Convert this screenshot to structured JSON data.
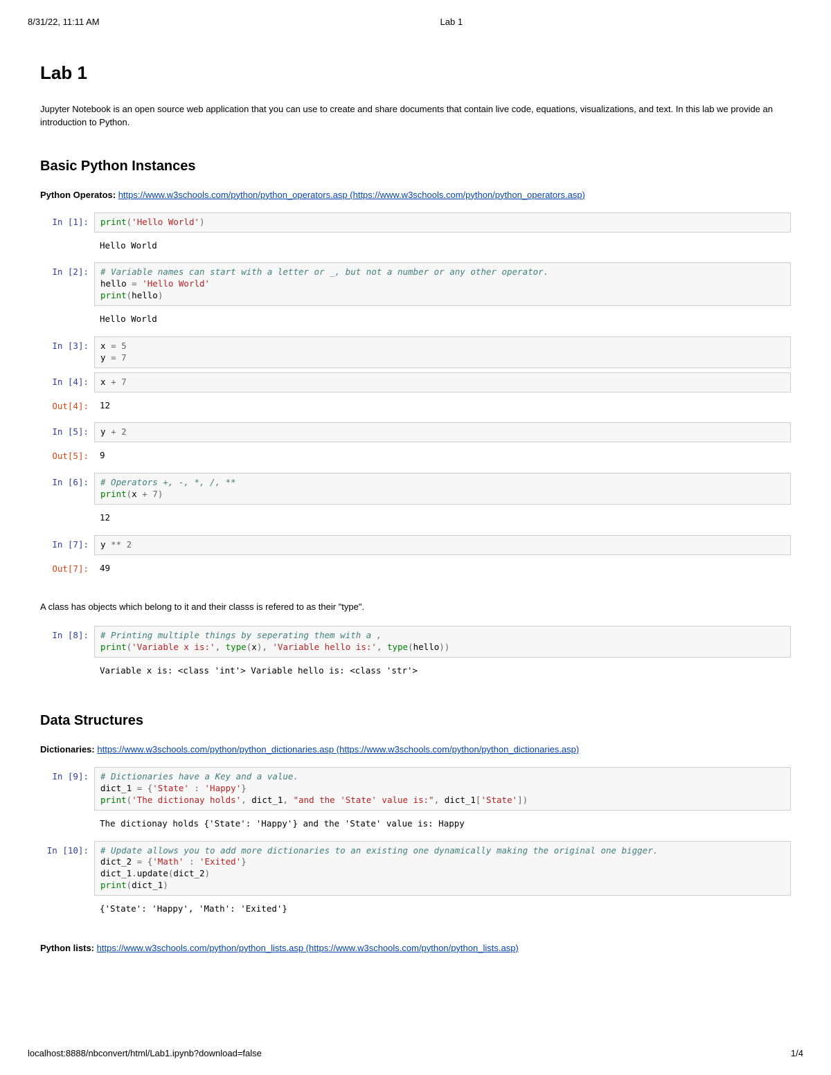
{
  "print": {
    "datetime": "8/31/22, 11:11 AM",
    "title": "Lab 1",
    "url": "localhost:8888/nbconvert/html/Lab1.ipynb?download=false",
    "page": "1/4"
  },
  "doc": {
    "h1": "Lab 1",
    "intro": "Jupyter Notebook is an open source web application that you can use to create and share documents that contain live code, equations, visualizations, and text. In this lab we provide an introduction to Python.",
    "h2a": "Basic Python Instances",
    "ref1_label": "Python Operatos:",
    "ref1_text": "https://www.w3schools.com/python/python_operators.asp (https://www.w3schools.com/python/python_operators.asp)",
    "class_note": "A class has objects which belong to it and their classs is refered to as their \"type\".",
    "h2b": "Data Structures",
    "ref2_label": "Dictionaries:",
    "ref2_text": "https://www.w3schools.com/python/python_dictionaries.asp (https://www.w3schools.com/python/python_dictionaries.asp)",
    "ref3_label": "Python lists:",
    "ref3_text": "https://www.w3schools.com/python/python_lists.asp (https://www.w3schools.com/python/python_lists.asp)"
  },
  "cells": {
    "c1": {
      "in": "In [1]:",
      "out_label": "",
      "stdout": "Hello World",
      "code": [
        [
          [
            "builtin",
            "print"
          ],
          [
            "op",
            "("
          ],
          [
            "str",
            "'Hello World'"
          ],
          [
            "op",
            ")"
          ]
        ]
      ]
    },
    "c2": {
      "in": "In [2]:",
      "stdout": "Hello World",
      "code": [
        [
          [
            "comment",
            "# Variable names can start with a letter or _, but not a number or any other operator."
          ]
        ],
        [
          [
            "name",
            "hello "
          ],
          [
            "op",
            "="
          ],
          [
            "name",
            " "
          ],
          [
            "str",
            "'Hello World'"
          ]
        ],
        [
          [
            "builtin",
            "print"
          ],
          [
            "op",
            "("
          ],
          [
            "name",
            "hello"
          ],
          [
            "op",
            ")"
          ]
        ]
      ]
    },
    "c3": {
      "in": "In [3]:",
      "code": [
        [
          [
            "name",
            "x "
          ],
          [
            "op",
            "="
          ],
          [
            "name",
            " "
          ],
          [
            "num",
            "5"
          ]
        ],
        [
          [
            "name",
            "y "
          ],
          [
            "op",
            "="
          ],
          [
            "name",
            " "
          ],
          [
            "num",
            "7"
          ]
        ]
      ]
    },
    "c4": {
      "in": "In [4]:",
      "out": "Out[4]:",
      "result": "12",
      "code": [
        [
          [
            "name",
            "x "
          ],
          [
            "op",
            "+"
          ],
          [
            "name",
            " "
          ],
          [
            "num",
            "7"
          ]
        ]
      ]
    },
    "c5": {
      "in": "In [5]:",
      "out": "Out[5]:",
      "result": "9",
      "code": [
        [
          [
            "name",
            "y "
          ],
          [
            "op",
            "+"
          ],
          [
            "name",
            " "
          ],
          [
            "num",
            "2"
          ]
        ]
      ]
    },
    "c6": {
      "in": "In [6]:",
      "stdout": "12",
      "code": [
        [
          [
            "comment",
            "# Operators +, -, *, /, **"
          ]
        ],
        [
          [
            "builtin",
            "print"
          ],
          [
            "op",
            "("
          ],
          [
            "name",
            "x "
          ],
          [
            "op",
            "+"
          ],
          [
            "name",
            " "
          ],
          [
            "num",
            "7"
          ],
          [
            "op",
            ")"
          ]
        ]
      ]
    },
    "c7": {
      "in": "In [7]:",
      "out": "Out[7]:",
      "result": "49",
      "code": [
        [
          [
            "name",
            "y "
          ],
          [
            "op",
            "**"
          ],
          [
            "name",
            " "
          ],
          [
            "num",
            "2"
          ]
        ]
      ]
    },
    "c8": {
      "in": "In [8]:",
      "stdout": "Variable x is: <class 'int'> Variable hello is: <class 'str'>",
      "code": [
        [
          [
            "comment",
            "# Printing multiple things by seperating them with a ,"
          ]
        ],
        [
          [
            "builtin",
            "print"
          ],
          [
            "op",
            "("
          ],
          [
            "str",
            "'Variable x is:'"
          ],
          [
            "op",
            ", "
          ],
          [
            "builtin",
            "type"
          ],
          [
            "op",
            "("
          ],
          [
            "name",
            "x"
          ],
          [
            "op",
            "), "
          ],
          [
            "str",
            "'Variable hello is:'"
          ],
          [
            "op",
            ", "
          ],
          [
            "builtin",
            "type"
          ],
          [
            "op",
            "("
          ],
          [
            "name",
            "hello"
          ],
          [
            "op",
            "))"
          ]
        ]
      ]
    },
    "c9": {
      "in": "In [9]:",
      "stdout": "The dictionay holds {'State': 'Happy'} and the 'State' value is: Happy",
      "code": [
        [
          [
            "comment",
            "# Dictionaries have a Key and a value."
          ]
        ],
        [
          [
            "name",
            "dict_1 "
          ],
          [
            "op",
            "= {"
          ],
          [
            "str",
            "'State'"
          ],
          [
            "op",
            " : "
          ],
          [
            "str",
            "'Happy'"
          ],
          [
            "op",
            "}"
          ]
        ],
        [
          [
            "builtin",
            "print"
          ],
          [
            "op",
            "("
          ],
          [
            "str",
            "'The dictionay holds'"
          ],
          [
            "op",
            ", "
          ],
          [
            "name",
            "dict_1"
          ],
          [
            "op",
            ", "
          ],
          [
            "str",
            "\"and the 'State' value is:\""
          ],
          [
            "op",
            ", "
          ],
          [
            "name",
            "dict_1"
          ],
          [
            "op",
            "["
          ],
          [
            "str",
            "'State'"
          ],
          [
            "op",
            "])"
          ]
        ]
      ]
    },
    "c10": {
      "in": "In [10]:",
      "stdout": "{'State': 'Happy', 'Math': 'Exited'}",
      "code": [
        [
          [
            "comment",
            "# Update allows you to add more dictionaries to an existing one dynamically making the original one bigger."
          ]
        ],
        [
          [
            "name",
            "dict_2 "
          ],
          [
            "op",
            "= {"
          ],
          [
            "str",
            "'Math'"
          ],
          [
            "op",
            " : "
          ],
          [
            "str",
            "'Exited'"
          ],
          [
            "op",
            "}"
          ]
        ],
        [
          [
            "name",
            "dict_1"
          ],
          [
            "op",
            "."
          ],
          [
            "name",
            "update"
          ],
          [
            "op",
            "("
          ],
          [
            "name",
            "dict_2"
          ],
          [
            "op",
            ")"
          ]
        ],
        [
          [
            "builtin",
            "print"
          ],
          [
            "op",
            "("
          ],
          [
            "name",
            "dict_1"
          ],
          [
            "op",
            ")"
          ]
        ]
      ]
    }
  }
}
